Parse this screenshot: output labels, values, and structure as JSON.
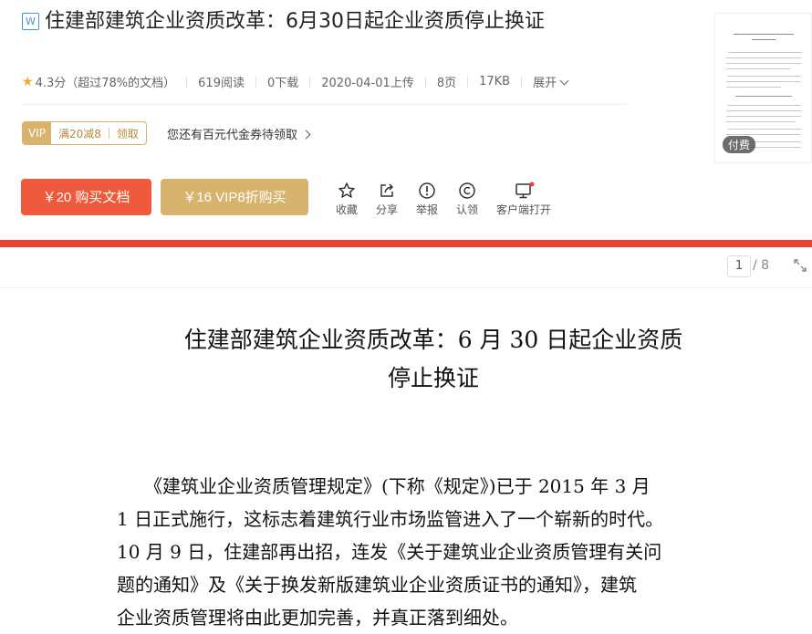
{
  "doc": {
    "type_icon": "W",
    "title": "住建部建筑企业资质改革：6月30日起企业资质停止换证"
  },
  "meta": {
    "rating": "4.3分",
    "rating_note": "（超过78%的文档）",
    "reads": "619阅读",
    "downloads": "0下载",
    "upload_date": "2020-04-01上传",
    "pages": "8页",
    "size": "17KB",
    "expand": "展开"
  },
  "coupon": {
    "vip_tag": "VIP",
    "offer": "满20减8",
    "claim": "领取",
    "link_text": "您还有百元代金券待领取"
  },
  "buttons": {
    "buy": "￥20 购买文档",
    "vip_buy": "￥16 VIP8折购买"
  },
  "actions": [
    {
      "label": "收藏",
      "icon": "star-outline-icon"
    },
    {
      "label": "分享",
      "icon": "share-icon"
    },
    {
      "label": "举报",
      "icon": "report-icon"
    },
    {
      "label": "认领",
      "icon": "copyright-icon"
    },
    {
      "label": "客户端打开",
      "icon": "monitor-icon"
    }
  ],
  "thumbnail": {
    "badge": "付费"
  },
  "viewer": {
    "current_page": "1",
    "total_pages": "/ 8"
  },
  "content": {
    "heading_line1": "住建部建筑企业资质改革：6 月 30 日起企业资质",
    "heading_line2": "停止换证",
    "body_lines": [
      "　　《建筑业企业资质管理规定》(下称《规定》)已于 2015 年 3 月",
      "1 日正式施行，这标志着建筑行业市场监管进入了一个崭新的时代。",
      "10 月 9 日，住建部再出招，连发《关于建筑业企业资质管理有关问",
      "题的通知》及《关于换发新版建筑业企业资质证书的通知》，建筑",
      "企业资质管理将由此更加完善，并真正落到细处。"
    ]
  },
  "colors": {
    "accent_red": "#f05a3c",
    "vip_gold": "#d8b36e",
    "reader_bar": "#e8432e",
    "star": "#f5a623",
    "notification_dot": "#e8432e"
  }
}
